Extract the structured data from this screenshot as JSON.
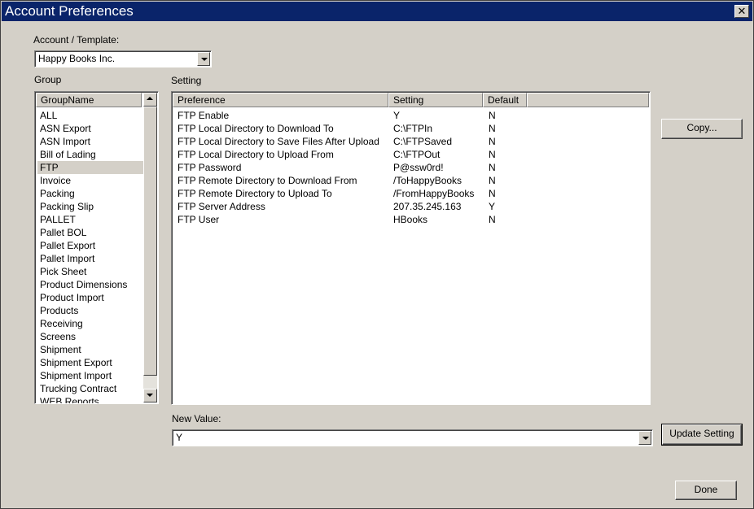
{
  "window": {
    "title": "Account Preferences",
    "close_label": "✕"
  },
  "account": {
    "label": "Account / Template:",
    "selected": "Happy Books Inc."
  },
  "group": {
    "label": "Group",
    "column_header": "GroupName",
    "selected": "FTP",
    "items": [
      "ALL",
      "ASN Export",
      "ASN Import",
      "Bill of Lading",
      "FTP",
      "Invoice",
      "Packing",
      "Packing Slip",
      "PALLET",
      "Pallet BOL",
      "Pallet Export",
      "Pallet Import",
      "Pick Sheet",
      "Product Dimensions",
      "Product Import",
      "Products",
      "Receiving",
      "Screens",
      "Shipment",
      "Shipment Export",
      "Shipment Import",
      "Trucking Contract",
      "WEB Reports"
    ]
  },
  "setting": {
    "label": "Setting",
    "columns": [
      "Preference",
      "Setting",
      "Default"
    ],
    "rows": [
      [
        "FTP Enable",
        "Y",
        "N"
      ],
      [
        "FTP Local Directory to Download To",
        "C:\\FTPIn",
        "N"
      ],
      [
        "FTP Local Directory to Save Files After Upload",
        "C:\\FTPSaved",
        "N"
      ],
      [
        "FTP Local Directory to Upload From",
        "C:\\FTPOut",
        "N"
      ],
      [
        "FTP Password",
        "P@ssw0rd!",
        "N"
      ],
      [
        "FTP Remote Directory to Download From",
        "/ToHappyBooks",
        "N"
      ],
      [
        "FTP Remote Directory to Upload To",
        "/FromHappyBooks",
        "N"
      ],
      [
        "FTP Server Address",
        "207.35.245.163",
        "Y"
      ],
      [
        "FTP User",
        "HBooks",
        "N"
      ]
    ]
  },
  "buttons": {
    "copy": "Copy...",
    "update": "Update Setting",
    "done": "Done"
  },
  "new_value": {
    "label": "New Value:",
    "value": "Y"
  },
  "colors": {
    "titlebar": "#0a246a",
    "face": "#d4d0c8",
    "selection": "#d4d0c8"
  }
}
